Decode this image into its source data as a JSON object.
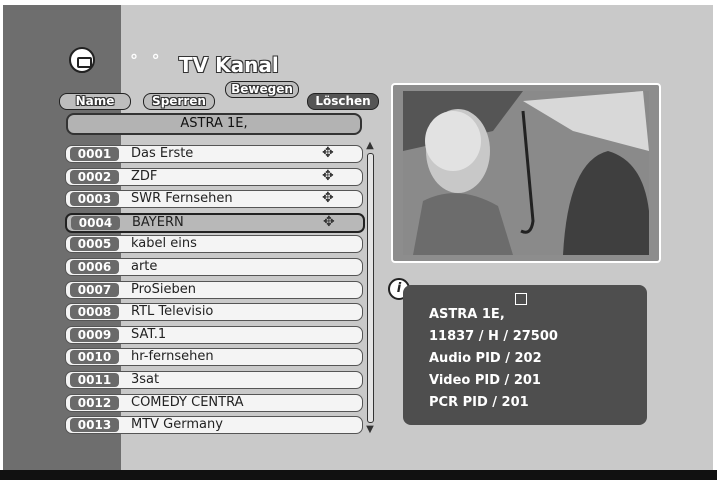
{
  "header": {
    "title": "TV Kanal",
    "title_dots": "° °",
    "icon": "tv-icon"
  },
  "buttons": {
    "name": "Name",
    "sperren": "Sperren",
    "bewegen": "Bewegen",
    "loeschen": "Löschen"
  },
  "satellite": "ASTRA 1E,",
  "channels": [
    {
      "num": "0001",
      "name": "Das Erste",
      "move": true
    },
    {
      "num": "0002",
      "name": "ZDF",
      "move": true
    },
    {
      "num": "0003",
      "name": "SWR Fernsehen",
      "move": true
    },
    {
      "num": "0004",
      "name": "BAYERN",
      "move": true,
      "selected": true
    },
    {
      "num": "0005",
      "name": "kabel eins",
      "move": false
    },
    {
      "num": "0006",
      "name": "arte",
      "move": false
    },
    {
      "num": "0007",
      "name": "ProSieben",
      "move": false
    },
    {
      "num": "0008",
      "name": "RTL Televisio",
      "move": false
    },
    {
      "num": "0009",
      "name": "SAT.1",
      "move": false
    },
    {
      "num": "0010",
      "name": "hr-fernsehen",
      "move": false
    },
    {
      "num": "0011",
      "name": "3sat",
      "move": false
    },
    {
      "num": "0012",
      "name": "COMEDY CENTRA",
      "move": false
    },
    {
      "num": "0013",
      "name": "MTV Germany",
      "move": false
    }
  ],
  "info": {
    "satellite": "ASTRA 1E,",
    "transponder": "11837 / H / 27500",
    "audio_pid": "Audio PID / 202",
    "video_pid": "Video PID / 201",
    "pcr_pid": "PCR PID / 201"
  },
  "icons": {
    "move": "move-arrows-icon",
    "info": "info-icon",
    "satellite": "satellite-icon"
  }
}
